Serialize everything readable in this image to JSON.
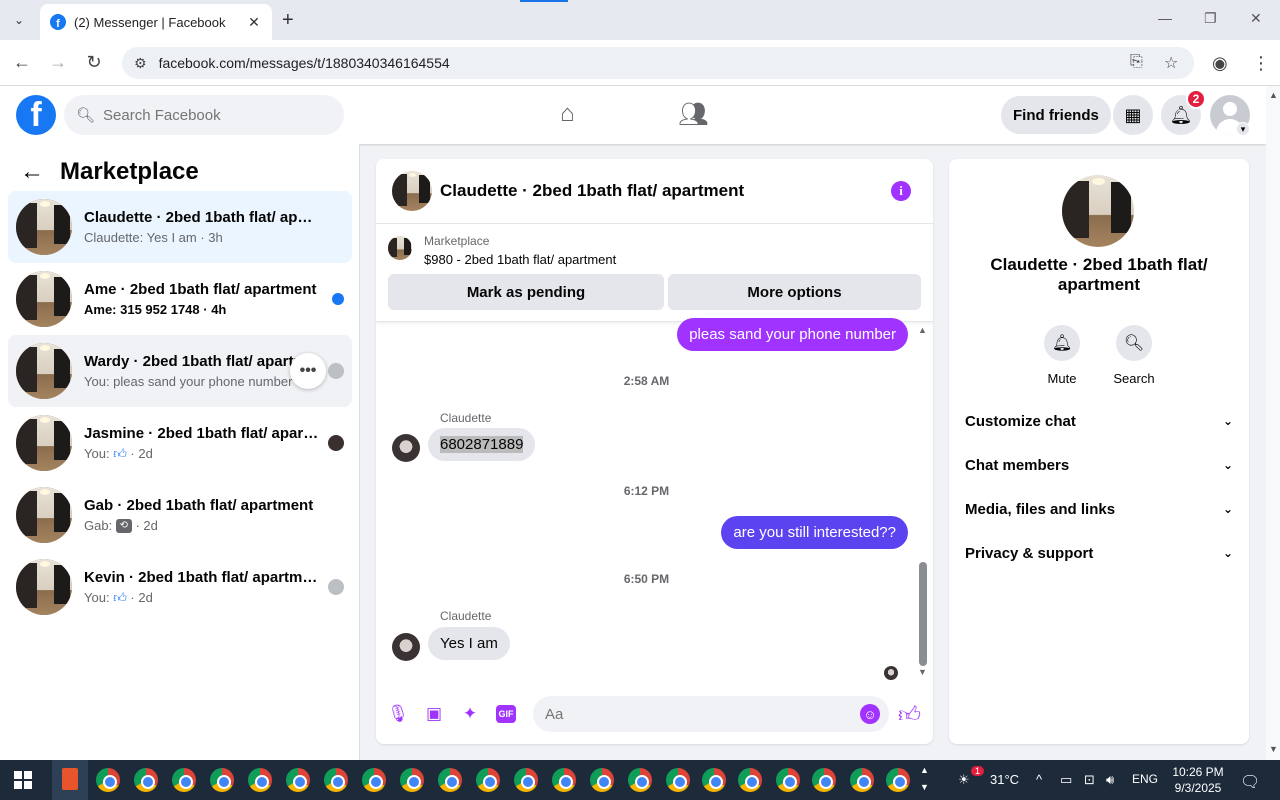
{
  "browser": {
    "tab_title": "(2) Messenger | Facebook",
    "url": "facebook.com/messages/t/1880340346164554"
  },
  "fb_header": {
    "search_placeholder": "Search Facebook",
    "find_friends_label": "Find friends",
    "notification_count": "2"
  },
  "left_pane": {
    "title": "Marketplace",
    "conversations": [
      {
        "name": "Claudette · 2bed 1bath flat/ apart...",
        "snippet": "Claudette: Yes I am · 3h",
        "unread": false,
        "active": true
      },
      {
        "name": "Ame · 2bed 1bath flat/ apartment",
        "snippet": "Ame: 315 952 1748 · 4h",
        "unread": true,
        "active": false
      },
      {
        "name": "Wardy · 2bed 1bath flat/ apartm",
        "snippet": "You: pleas sand your phone number",
        "unread": false,
        "active": false
      },
      {
        "name": "Jasmine · 2bed 1bath flat/ apart...",
        "snippet_prefix": "You:",
        "snippet_suffix": "· 2d",
        "unread": false,
        "active": false
      },
      {
        "name": "Gab · 2bed 1bath flat/ apartment",
        "snippet_prefix": "Gab:",
        "snippet_suffix": "· 2d",
        "unread": false,
        "active": false
      },
      {
        "name": "Kevin · 2bed 1bath flat/ apartme...",
        "snippet_prefix": "You:",
        "snippet_suffix": "· 2d",
        "unread": false,
        "active": false
      }
    ]
  },
  "chat": {
    "header_name": "Claudette · 2bed 1bath flat/ apartment",
    "marketplace_label": "Marketplace",
    "listing": "$980 - 2bed 1bath flat/ apartment",
    "mark_pending_label": "Mark as pending",
    "more_options_label": "More options",
    "messages": [
      {
        "type": "out",
        "text": "pleas sand your phone number"
      },
      {
        "type": "time",
        "text": "2:58 AM"
      },
      {
        "type": "sender",
        "text": "Claudette"
      },
      {
        "type": "in",
        "text": "6802871889"
      },
      {
        "type": "time",
        "text": "6:12 PM"
      },
      {
        "type": "out",
        "text": "are you still interested??"
      },
      {
        "type": "time",
        "text": "6:50 PM"
      },
      {
        "type": "sender",
        "text": "Claudette"
      },
      {
        "type": "in",
        "text": "Yes I am"
      }
    ],
    "composer_placeholder": "Aa"
  },
  "right_pane": {
    "name": "Claudette · 2bed 1bath flat/ apartment",
    "mute_label": "Mute",
    "search_label": "Search",
    "sections": [
      "Customize chat",
      "Chat members",
      "Media, files and links",
      "Privacy & support"
    ]
  },
  "taskbar": {
    "temperature": "31°C",
    "weather_badge": "1",
    "language": "ENG",
    "time": "10:26 PM",
    "date": "9/3/2025"
  },
  "colors": {
    "fb_blue": "#1877f2",
    "messenger_purple": "#a033ff",
    "outgoing_blue": "#5b44f0",
    "notification_red": "#e41e3f"
  }
}
